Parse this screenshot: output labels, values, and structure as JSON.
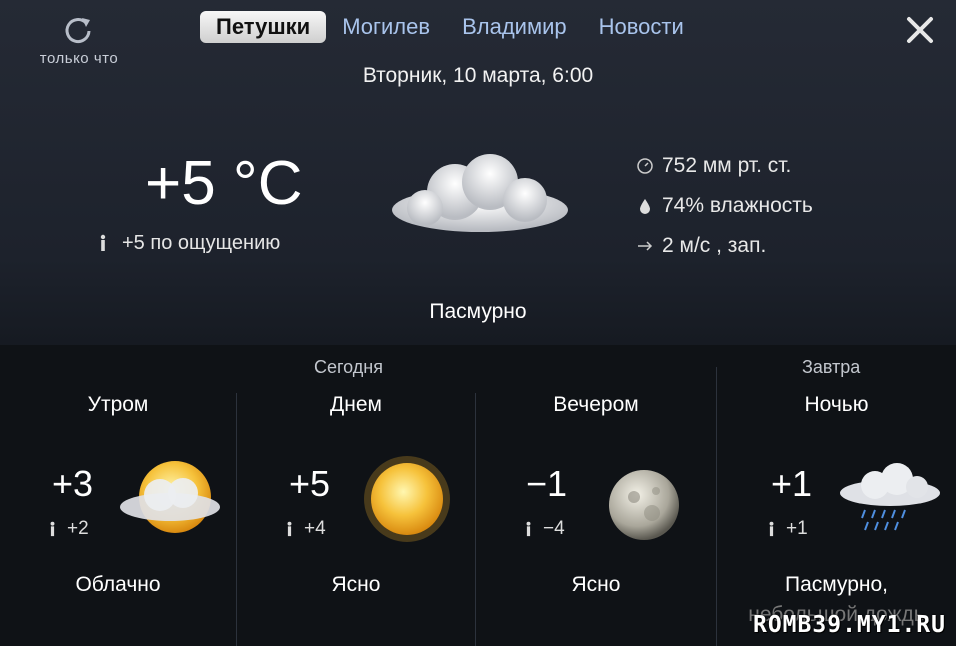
{
  "refresh": {
    "label": "только что",
    "icon": "refresh-icon"
  },
  "tabs": [
    "Петушки",
    "Могилев",
    "Владимир",
    "Новости"
  ],
  "active_tab": "Петушки",
  "date": "Вторник, 10 марта, 6:00",
  "current": {
    "temperature": "+5 °C",
    "feels": "+5 по ощущению",
    "pressure": "752 мм рт. ст.",
    "humidity": "74% влажность",
    "wind": "2 м/с , зап.",
    "condition": "Пасмурно",
    "icon": "overcast-cloud-icon"
  },
  "groups": {
    "today": "Сегодня",
    "tomorrow": "Завтра"
  },
  "periods": [
    {
      "name": "Утром",
      "temp": "+3",
      "feels": "+2",
      "condition": "Облачно",
      "icon": "sun-behind-cloud-icon"
    },
    {
      "name": "Днем",
      "temp": "+5",
      "feels": "+4",
      "condition": "Ясно",
      "icon": "sun-icon"
    },
    {
      "name": "Вечером",
      "temp": "−1",
      "feels": "−4",
      "condition": "Ясно",
      "icon": "moon-icon"
    },
    {
      "name": "Ночью",
      "temp": "+1",
      "feels": "+1",
      "condition": "Пасмурно,",
      "condition2": "небольшой дождь",
      "icon": "rain-cloud-icon"
    }
  ],
  "watermark": "ROMB39.MY1.RU",
  "colors": {
    "tab_text": "#a9c4ec",
    "background": "#1d222c",
    "sun": "#f5b52a"
  }
}
